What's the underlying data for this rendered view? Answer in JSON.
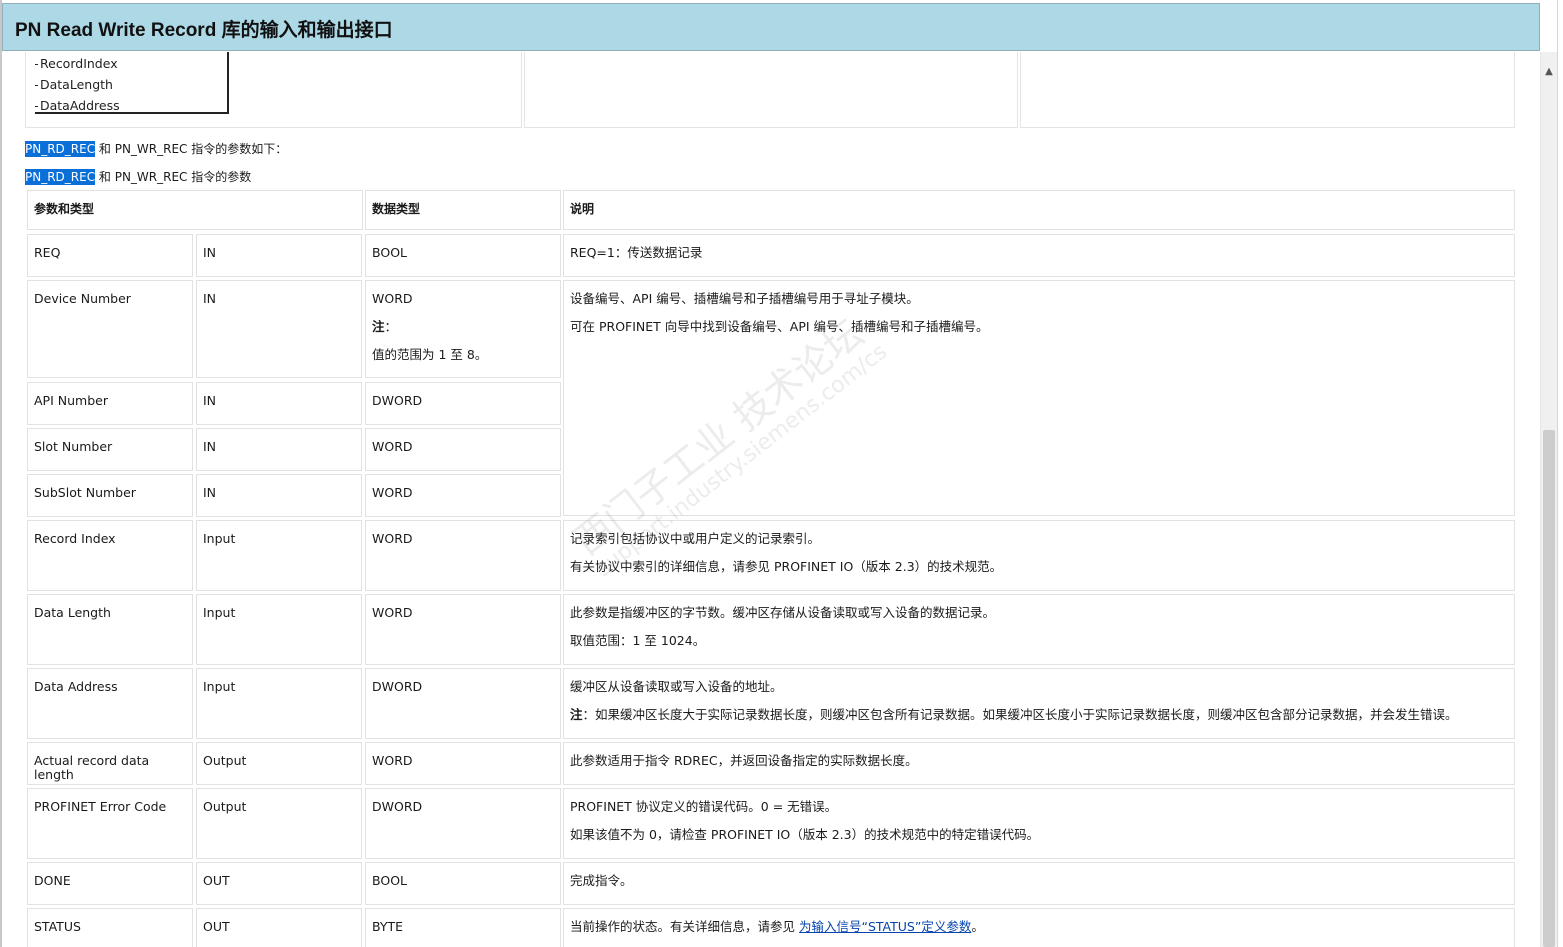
{
  "window": {
    "title": "PN Read Write Record 库的输入和输出接口"
  },
  "block_pins": [
    "RecordIndex",
    "DataLength",
    "DataAddress"
  ],
  "intro": {
    "line1_highlight": "PN_RD_REC",
    "line1_rest": " 和 PN_WR_REC 指令的参数如下：",
    "line2_highlight": "PN_RD_REC",
    "line2_rest": " 和 PN_WR_REC 指令的参数"
  },
  "table": {
    "headers": {
      "param": "参数和类型",
      "dtype": "数据类型",
      "desc": "说明"
    },
    "rows": [
      {
        "name": "REQ",
        "io": "IN",
        "type": "BOOL",
        "desc": [
          "REQ=1：传送数据记录"
        ]
      },
      {
        "name": "Device Number",
        "io": "IN",
        "type": "WORD",
        "type_note_label": "注",
        "type_note_colon": "：",
        "type_note": "值的范围为 1 至 8。",
        "desc": [
          "设备编号、API 编号、插槽编号和子插槽编号用于寻址子模块。",
          "可在 PROFINET 向导中找到设备编号、API 编号、插槽编号和子插槽编号。"
        ]
      },
      {
        "name": "API Number",
        "io": "IN",
        "type": "DWORD"
      },
      {
        "name": "Slot Number",
        "io": "IN",
        "type": "WORD"
      },
      {
        "name": "SubSlot Number",
        "io": "IN",
        "type": "WORD"
      },
      {
        "name": "Record Index",
        "io": "Input",
        "type": "WORD",
        "desc": [
          "记录索引包括协议中或用户定义的记录索引。",
          "有关协议中索引的详细信息，请参见 PROFINET IO（版本 2.3）的技术规范。"
        ]
      },
      {
        "name": "Data Length",
        "io": "Input",
        "type": "WORD",
        "desc": [
          "此参数是指缓冲区的字节数。缓冲区存储从设备读取或写入设备的数据记录。",
          "取值范围：1 至 1024。"
        ]
      },
      {
        "name": "Data Address",
        "io": "Input",
        "type": "DWORD",
        "desc": [
          "缓冲区从设备读取或写入设备的地址。"
        ],
        "note_label": "注",
        "note_text": "：如果缓冲区长度大于实际记录数据长度，则缓冲区包含所有记录数据。如果缓冲区长度小于实际记录数据长度，则缓冲区包含部分记录数据，并会发生错误。"
      },
      {
        "name": "Actual record data length",
        "io": "Output",
        "type": "WORD",
        "desc": [
          "此参数适用于指令 RDREC，并返回设备指定的实际数据长度。"
        ]
      },
      {
        "name": "PROFINET Error Code",
        "io": "Output",
        "type": "DWORD",
        "desc": [
          "PROFINET 协议定义的错误代码。0 = 无错误。",
          "如果该值不为 0，请检查 PROFINET IO（版本 2.3）的技术规范中的特定错误代码。"
        ]
      },
      {
        "name": "DONE",
        "io": "OUT",
        "type": "BOOL",
        "desc": [
          "完成指令。"
        ]
      },
      {
        "name": "STATUS",
        "io": "OUT",
        "type": "BYTE",
        "desc_prefix": "当前操作的状态。有关详细信息，请参见 ",
        "desc_link": "为输入信号“STATUS”定义参数",
        "desc_suffix": "。"
      }
    ]
  },
  "watermark": {
    "line1": "西门子工业 技术论坛",
    "line2": "support.industry.siemens.com/cs"
  },
  "colors": {
    "title_bar": "#add8e6",
    "highlight": "#0a6fd6",
    "link": "#0645ad"
  }
}
